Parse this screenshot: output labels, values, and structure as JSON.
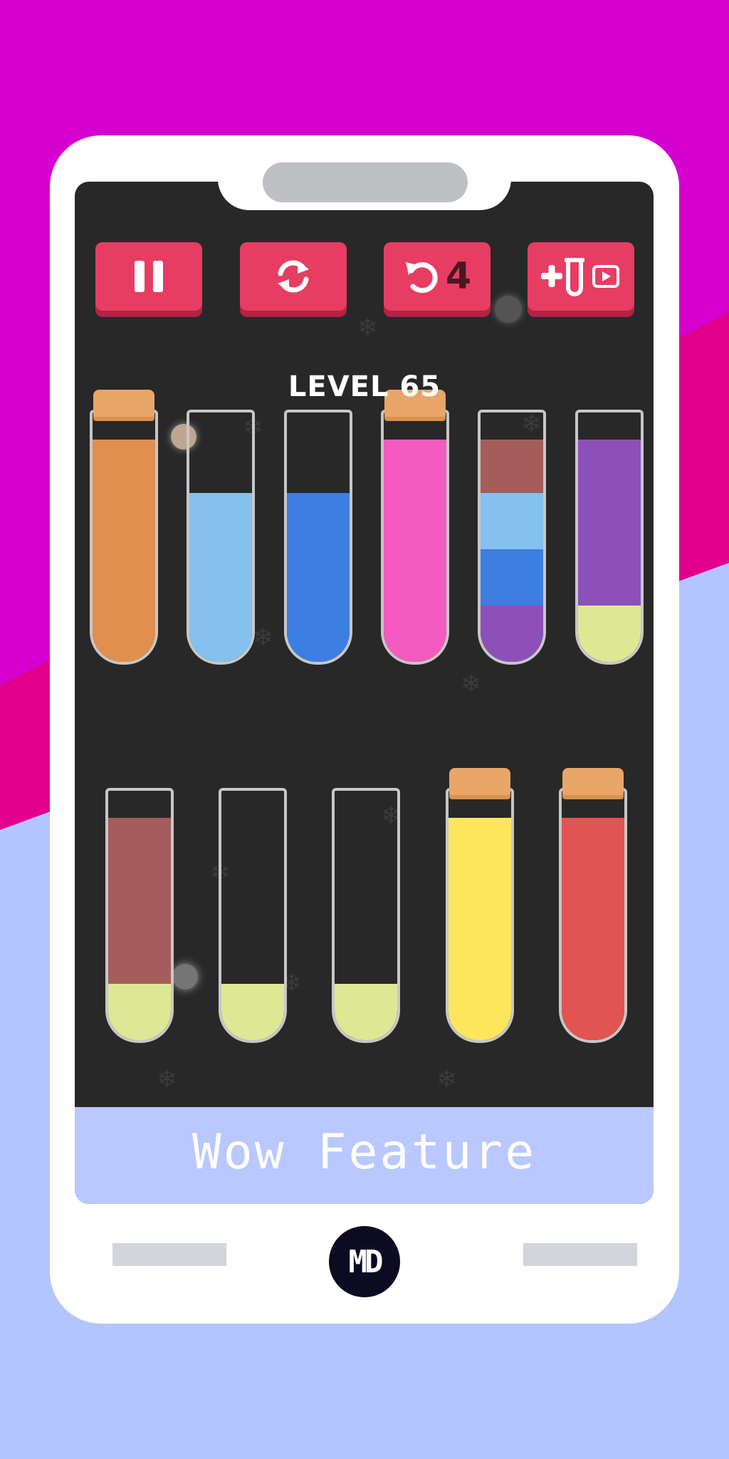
{
  "level": {
    "title": "LEVEL 65"
  },
  "toolbar": {
    "pause_icon": "pause-icon",
    "restart_icon": "restart-icon",
    "undo_icon": "undo-icon",
    "undo_count": "4",
    "add_tube_icon": "add-tube-video-icon",
    "button_color": "#e73d62"
  },
  "colors": {
    "orange": "#e08f4d",
    "light_blue": "#84c1ef",
    "blue": "#3c7ee2",
    "pink": "#f45abf",
    "brown": "#a55d5b",
    "purple": "#8d50b8",
    "pale_yellow": "#dee894",
    "yellow": "#fee65c",
    "red": "#e05452",
    "background_top": "#d500d0",
    "background_bottom": "#b3c5fe"
  },
  "tubes": [
    {
      "id": 1,
      "corked": true,
      "layers_bottom_to_top": [
        "orange",
        "orange",
        "orange",
        "orange"
      ]
    },
    {
      "id": 2,
      "corked": false,
      "layers_bottom_to_top": [
        "light_blue",
        "light_blue",
        "light_blue"
      ]
    },
    {
      "id": 3,
      "corked": false,
      "layers_bottom_to_top": [
        "blue",
        "blue",
        "blue"
      ]
    },
    {
      "id": 4,
      "corked": true,
      "layers_bottom_to_top": [
        "pink",
        "pink",
        "pink",
        "pink"
      ]
    },
    {
      "id": 5,
      "corked": false,
      "layers_bottom_to_top": [
        "purple",
        "blue",
        "light_blue",
        "brown"
      ]
    },
    {
      "id": 6,
      "corked": false,
      "layers_bottom_to_top": [
        "pale_yellow",
        "purple",
        "purple",
        "purple"
      ]
    },
    {
      "id": 7,
      "corked": false,
      "layers_bottom_to_top": [
        "pale_yellow",
        "brown",
        "brown",
        "brown"
      ]
    },
    {
      "id": 8,
      "corked": false,
      "layers_bottom_to_top": [
        "pale_yellow"
      ]
    },
    {
      "id": 9,
      "corked": false,
      "layers_bottom_to_top": [
        "pale_yellow"
      ]
    },
    {
      "id": 10,
      "corked": true,
      "layers_bottom_to_top": [
        "yellow",
        "yellow",
        "yellow",
        "yellow"
      ]
    },
    {
      "id": 11,
      "corked": true,
      "layers_bottom_to_top": [
        "red",
        "red",
        "red",
        "red"
      ]
    }
  ],
  "footer": {
    "caption": "Wow Feature",
    "logo_text": "MD"
  }
}
